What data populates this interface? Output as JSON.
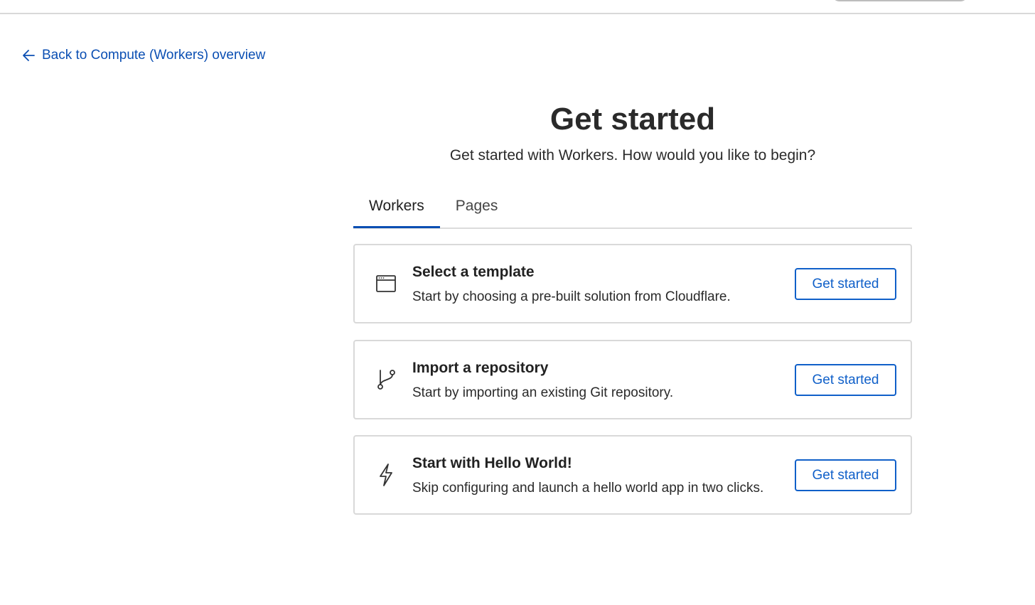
{
  "nav": {
    "back_link": "Back to Compute (Workers) overview"
  },
  "header": {
    "title": "Get started",
    "subtitle": "Get started with Workers. How would you like to begin?"
  },
  "tabs": [
    {
      "label": "Workers",
      "active": true
    },
    {
      "label": "Pages",
      "active": false
    }
  ],
  "options": [
    {
      "icon": "browser-window-icon",
      "title": "Select a template",
      "description": "Start by choosing a pre-built solution from Cloudflare.",
      "button": "Get started"
    },
    {
      "icon": "git-branch-icon",
      "title": "Import a repository",
      "description": "Start by importing an existing Git repository.",
      "button": "Get started"
    },
    {
      "icon": "lightning-bolt-icon",
      "title": "Start with Hello World!",
      "description": "Skip configuring and launch a hello world app in two clicks.",
      "button": "Get started"
    }
  ],
  "colors": {
    "accent": "#0b4fb3",
    "button_border": "#1060c9",
    "card_border": "#d9d9d9"
  }
}
